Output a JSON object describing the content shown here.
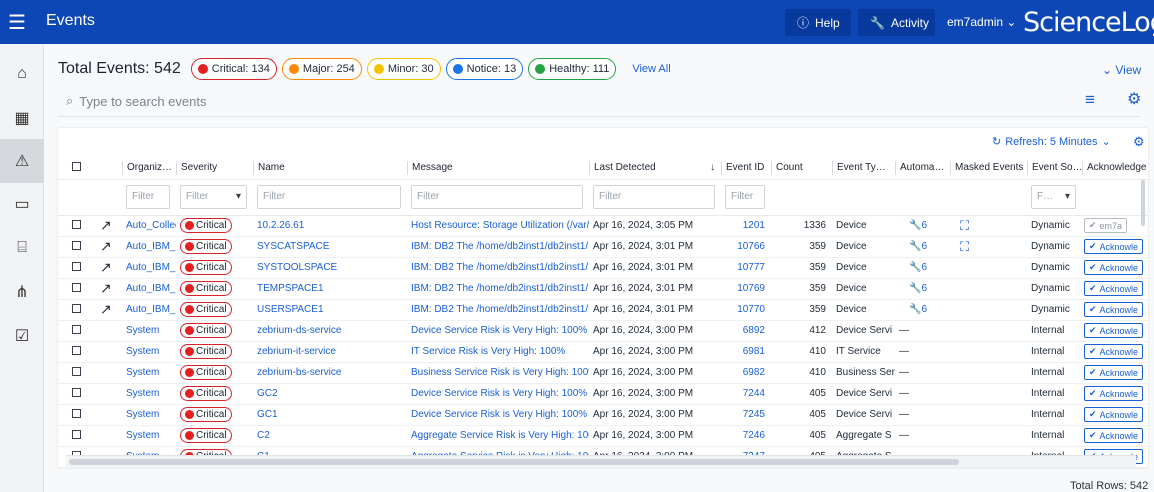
{
  "topbar": {
    "menu_icon": "hamburger-icon",
    "title": "Events",
    "help_label": "Help",
    "activity_label": "Activity",
    "user_label": "em7admin ⌄",
    "logo": "ScienceLogic"
  },
  "sidebar": [
    "home-icon",
    "dashboard-icon",
    "alert-icon",
    "devices-icon",
    "briefcase-icon",
    "topology-icon",
    "checklist-icon"
  ],
  "summary": {
    "total_label": "Total Events: 542",
    "pills": [
      {
        "label": "Critical: 134",
        "color": "#e3201f",
        "border": "#d9222a"
      },
      {
        "label": "Major: 254",
        "color": "#ff8a00",
        "border": "#ff8a00"
      },
      {
        "label": "Minor: 30",
        "color": "#f4c300",
        "border": "#f4c300"
      },
      {
        "label": "Notice: 13",
        "color": "#1a73e8",
        "border": "#1a73e8"
      },
      {
        "label": "Healthy: 111",
        "color": "#25a244",
        "border": "#25a244"
      }
    ],
    "view_all": "View All",
    "view_label": "⌄ View"
  },
  "search": {
    "placeholder": "Type to search events"
  },
  "refresh_label": "Refresh: 5 Minutes",
  "columns": [
    "Organiz…",
    "Severity",
    "Name",
    "Message",
    "Last Detected",
    "Event ID",
    "Count",
    "Event Ty…",
    "Automa…",
    "Masked Events",
    "Event So…",
    "Acknowledge"
  ],
  "filters": {
    "filter_label": "Filter",
    "f_label": "F…"
  },
  "rows": [
    {
      "org": "Auto_Collec",
      "severity": "Critical",
      "name": "10.2.26.61",
      "message": "Host Resource: Storage Utilization (/var/log",
      "detected": "Apr 16, 2024, 3:05 PM",
      "event_id": "1201",
      "count": "1336",
      "type": "Device",
      "auto": "6",
      "masked": true,
      "source": "Dynamic",
      "ack": "em7a",
      "acked": true
    },
    {
      "org": "Auto_IBM_D",
      "severity": "Critical",
      "name": "SYSCATSPACE",
      "message": "IBM: DB2 The /home/db2inst1/db2inst1/N(",
      "detected": "Apr 16, 2024, 3:01 PM",
      "event_id": "10766",
      "count": "359",
      "type": "Device",
      "auto": "6",
      "masked": true,
      "source": "Dynamic",
      "ack": "Acknowle",
      "acked": false
    },
    {
      "org": "Auto_IBM_D",
      "severity": "Critical",
      "name": "SYSTOOLSPACE",
      "message": "IBM: DB2 The /home/db2inst1/db2inst1/N(",
      "detected": "Apr 16, 2024, 3:01 PM",
      "event_id": "10777",
      "count": "359",
      "type": "Device",
      "auto": "6",
      "masked": false,
      "source": "Dynamic",
      "ack": "Acknowle",
      "acked": false
    },
    {
      "org": "Auto_IBM_D",
      "severity": "Critical",
      "name": "TEMPSPACE1",
      "message": "IBM: DB2 The /home/db2inst1/db2inst1/N(",
      "detected": "Apr 16, 2024, 3:01 PM",
      "event_id": "10769",
      "count": "359",
      "type": "Device",
      "auto": "6",
      "masked": false,
      "source": "Dynamic",
      "ack": "Acknowle",
      "acked": false
    },
    {
      "org": "Auto_IBM_D",
      "severity": "Critical",
      "name": "USERSPACE1",
      "message": "IBM: DB2 The /home/db2inst1/db2inst1/N(",
      "detected": "Apr 16, 2024, 3:01 PM",
      "event_id": "10770",
      "count": "359",
      "type": "Device",
      "auto": "6",
      "masked": false,
      "source": "Dynamic",
      "ack": "Acknowle",
      "acked": false
    },
    {
      "org": "System",
      "severity": "Critical",
      "name": "zebrium-ds-service",
      "message": "Device Service Risk is Very High: 100%",
      "detected": "Apr 16, 2024, 3:00 PM",
      "event_id": "6892",
      "count": "412",
      "type": "Device Servi",
      "auto": "—",
      "masked": false,
      "source": "Internal",
      "ack": "Acknowle",
      "acked": false
    },
    {
      "org": "System",
      "severity": "Critical",
      "name": "zebrium-it-service",
      "message": "IT Service Risk is Very High: 100%",
      "detected": "Apr 16, 2024, 3:00 PM",
      "event_id": "6981",
      "count": "410",
      "type": "IT Service",
      "auto": "—",
      "masked": false,
      "source": "Internal",
      "ack": "Acknowle",
      "acked": false
    },
    {
      "org": "System",
      "severity": "Critical",
      "name": "zebrium-bs-service",
      "message": "Business Service Risk is Very High: 100%",
      "detected": "Apr 16, 2024, 3:00 PM",
      "event_id": "6982",
      "count": "410",
      "type": "Business Ser",
      "auto": "—",
      "masked": false,
      "source": "Internal",
      "ack": "Acknowle",
      "acked": false
    },
    {
      "org": "System",
      "severity": "Critical",
      "name": "GC2",
      "message": "Device Service Risk is Very High: 100%",
      "detected": "Apr 16, 2024, 3:00 PM",
      "event_id": "7244",
      "count": "405",
      "type": "Device Servi",
      "auto": "—",
      "masked": false,
      "source": "Internal",
      "ack": "Acknowle",
      "acked": false
    },
    {
      "org": "System",
      "severity": "Critical",
      "name": "GC1",
      "message": "Device Service Risk is Very High: 100%",
      "detected": "Apr 16, 2024, 3:00 PM",
      "event_id": "7245",
      "count": "405",
      "type": "Device Servi",
      "auto": "—",
      "masked": false,
      "source": "Internal",
      "ack": "Acknowle",
      "acked": false
    },
    {
      "org": "System",
      "severity": "Critical",
      "name": "C2",
      "message": "Aggregate Service Risk is Very High: 100%",
      "detected": "Apr 16, 2024, 3:00 PM",
      "event_id": "7246",
      "count": "405",
      "type": "Aggregate S",
      "auto": "—",
      "masked": false,
      "source": "Internal",
      "ack": "Acknowle",
      "acked": false
    },
    {
      "org": "System",
      "severity": "Critical",
      "name": "C1",
      "message": "Aggregate Service Risk is Very High: 100%",
      "detected": "Apr 16, 2024, 3:00 PM",
      "event_id": "7247",
      "count": "405",
      "type": "Aggregate S",
      "auto": "—",
      "masked": false,
      "source": "Internal",
      "ack": "Acknowle",
      "acked": false
    }
  ],
  "total_rows": "Total Rows: 542"
}
